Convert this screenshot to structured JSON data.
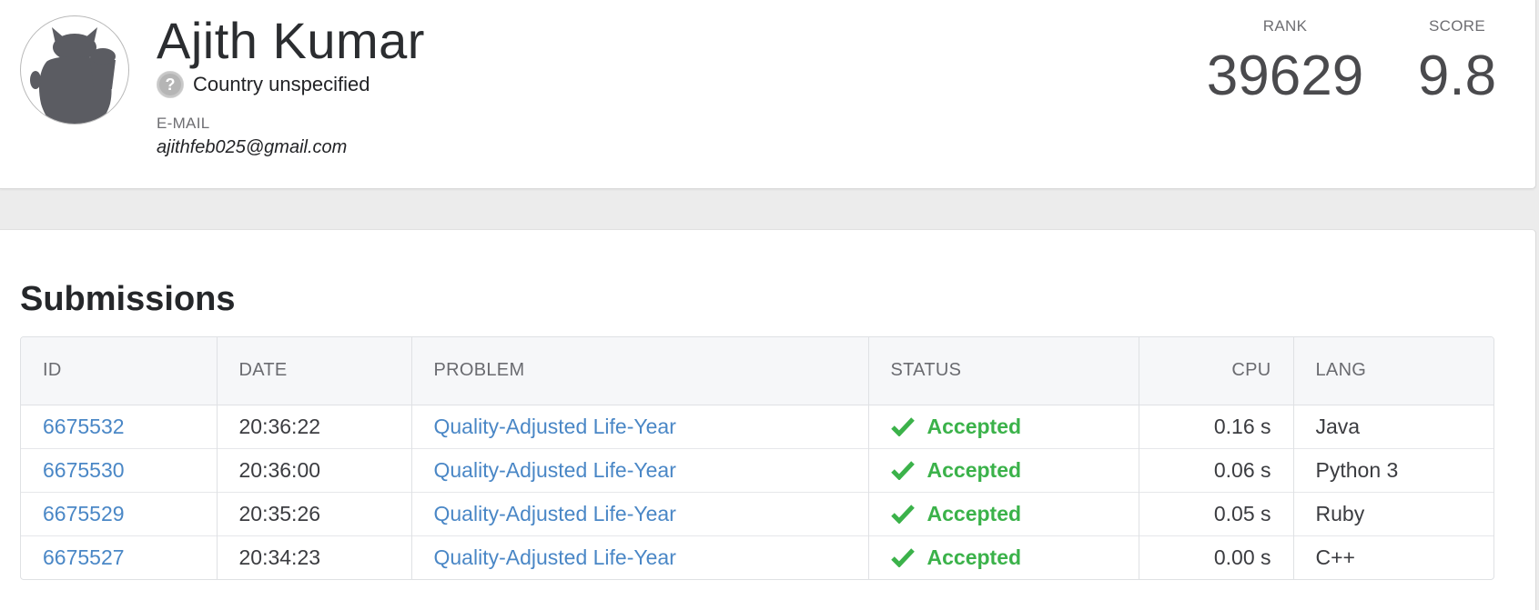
{
  "profile": {
    "name": "Ajith Kumar",
    "avatar_icon": "cat-avatar-icon",
    "country_flag_icon": "question-mark-flag-icon",
    "country_flag_glyph": "?",
    "country": "Country unspecified",
    "email_label": "E-MAIL",
    "email": "ajithfeb025@gmail.com",
    "rank_label": "RANK",
    "rank": "39629",
    "score_label": "SCORE",
    "score": "9.8"
  },
  "submissions": {
    "title": "Submissions",
    "columns": {
      "id": "ID",
      "date": "DATE",
      "problem": "PROBLEM",
      "status": "STATUS",
      "cpu": "CPU",
      "lang": "LANG"
    },
    "status_icon": "checkmark-icon",
    "rows": [
      {
        "id": "6675532",
        "date": "20:36:22",
        "problem": "Quality-Adjusted Life-Year",
        "status": "Accepted",
        "cpu": "0.16 s",
        "lang": "Java"
      },
      {
        "id": "6675530",
        "date": "20:36:00",
        "problem": "Quality-Adjusted Life-Year",
        "status": "Accepted",
        "cpu": "0.06 s",
        "lang": "Python 3"
      },
      {
        "id": "6675529",
        "date": "20:35:26",
        "problem": "Quality-Adjusted Life-Year",
        "status": "Accepted",
        "cpu": "0.05 s",
        "lang": "Ruby"
      },
      {
        "id": "6675527",
        "date": "20:34:23",
        "problem": "Quality-Adjusted Life-Year",
        "status": "Accepted",
        "cpu": "0.00 s",
        "lang": "C++"
      }
    ]
  },
  "colors": {
    "link": "#4a87c6",
    "accepted": "#3bb24a",
    "page_background": "#ececec",
    "table_header_background": "#f6f7f9"
  }
}
